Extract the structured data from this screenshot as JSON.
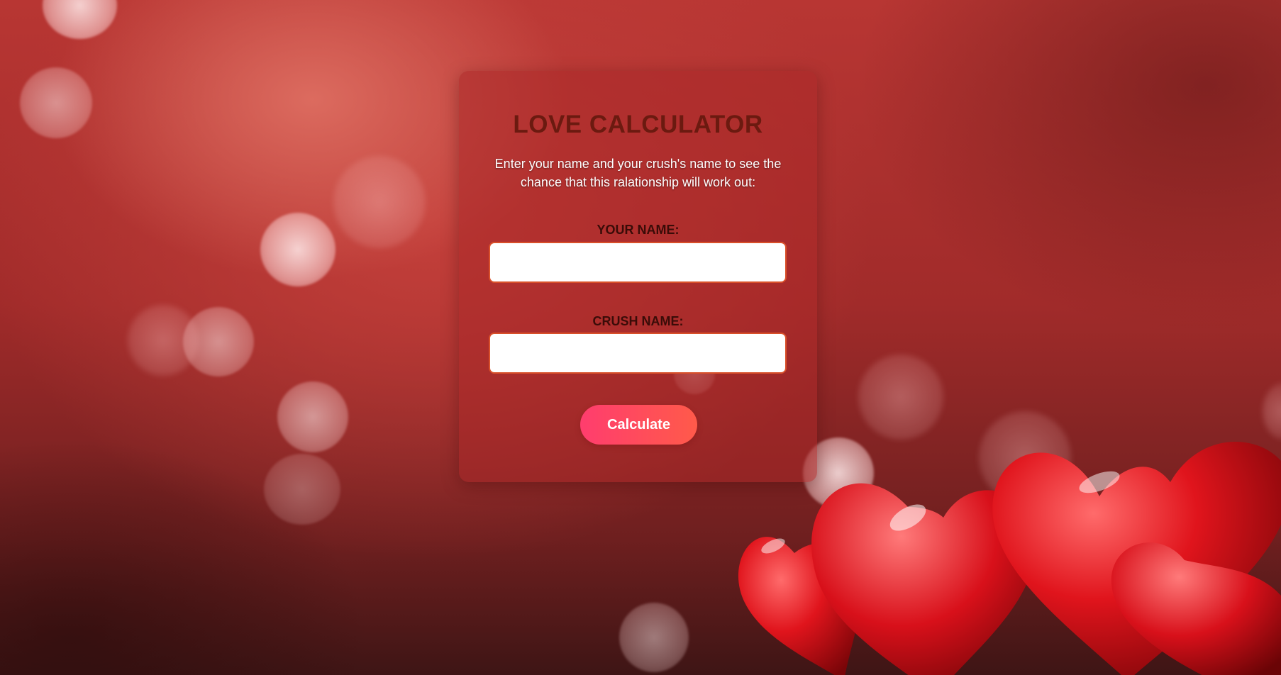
{
  "card": {
    "title": "LOVE CALCULATOR",
    "subtitle": "Enter your name and your crush's name to see the chance that this ralationship will work out:"
  },
  "form": {
    "your_name_label": "YOUR NAME:",
    "your_name_value": "",
    "crush_name_label": "CRUSH NAME:",
    "crush_name_value": "",
    "calculate_label": "Calculate"
  },
  "colors": {
    "title": "#6b1a10",
    "field_border": "#d9502a",
    "button_start": "#ff3d6e",
    "button_end": "#ff5a4a"
  },
  "decor": {
    "background_icon": "bokeh-background",
    "hearts_icon": "red-hearts-decoration"
  }
}
